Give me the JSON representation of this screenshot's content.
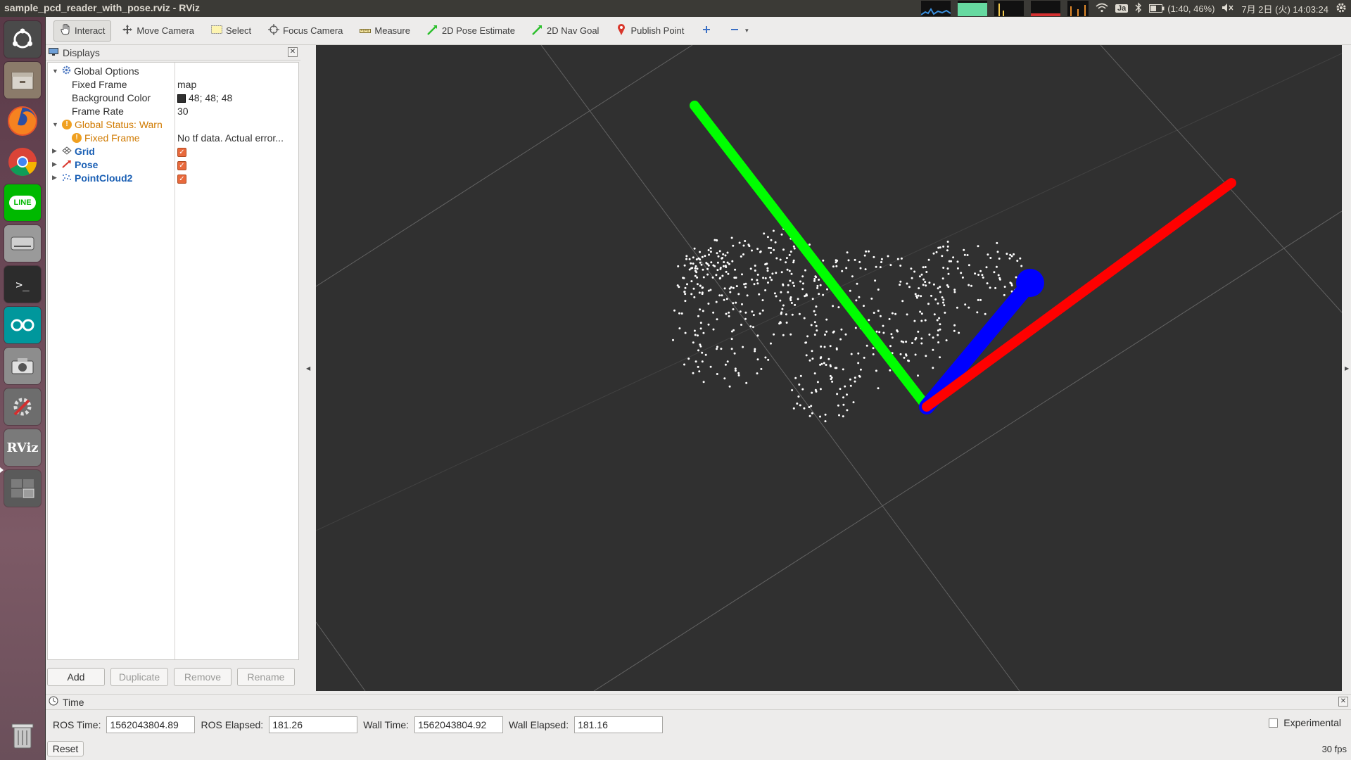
{
  "window": {
    "title": "sample_pcd_reader_with_pose.rviz - RViz"
  },
  "tray": {
    "keyboard": "Ja",
    "battery": "(1:40, 46%)",
    "datetime": "7月 2日 (火) 14:03:24"
  },
  "toolbar": {
    "tools": [
      {
        "label": "Interact",
        "icon": "hand-icon",
        "active": true
      },
      {
        "label": "Move Camera",
        "icon": "move-camera-icon"
      },
      {
        "label": "Select",
        "icon": "select-icon"
      },
      {
        "label": "Focus Camera",
        "icon": "focus-camera-icon"
      },
      {
        "label": "Measure",
        "icon": "ruler-icon"
      },
      {
        "label": "2D Pose Estimate",
        "icon": "pose-estimate-arrow-icon"
      },
      {
        "label": "2D Nav Goal",
        "icon": "nav-goal-arrow-icon"
      },
      {
        "label": "Publish Point",
        "icon": "map-pin-icon"
      }
    ]
  },
  "displays": {
    "title": "Displays",
    "global_options": {
      "label": "Global Options",
      "fixed_frame_label": "Fixed Frame",
      "fixed_frame_value": "map",
      "bg_color_label": "Background Color",
      "bg_color_value": "48; 48; 48",
      "bg_color_hex": "#303030",
      "frame_rate_label": "Frame Rate",
      "frame_rate_value": "30"
    },
    "global_status": {
      "label": "Global Status: Warn",
      "fixed_frame_label": "Fixed Frame",
      "fixed_frame_value": "No tf data.  Actual error..."
    },
    "items": [
      {
        "label": "Grid",
        "icon": "grid-icon",
        "checked": true
      },
      {
        "label": "Pose",
        "icon": "pose-arrow-icon",
        "checked": true
      },
      {
        "label": "PointCloud2",
        "icon": "point-cloud-icon",
        "checked": true
      }
    ],
    "buttons": {
      "add": "Add",
      "duplicate": "Duplicate",
      "remove": "Remove",
      "rename": "Rename"
    }
  },
  "time": {
    "title": "Time",
    "ros_time_label": "ROS Time:",
    "ros_time_value": "1562043804.89",
    "ros_elapsed_label": "ROS Elapsed:",
    "ros_elapsed_value": "181.26",
    "wall_time_label": "Wall Time:",
    "wall_time_value": "1562043804.92",
    "wall_elapsed_label": "Wall Elapsed:",
    "wall_elapsed_value": "181.16",
    "experimental_label": "Experimental",
    "reset_label": "Reset",
    "fps": "30 fps"
  },
  "colors": {
    "viewport_bg": "#303030",
    "axis_x": "#ff0000",
    "axis_y": "#00ff00",
    "axis_z": "#0000ff",
    "warn": "#d07a00",
    "display_name": "#1a5fb4"
  }
}
